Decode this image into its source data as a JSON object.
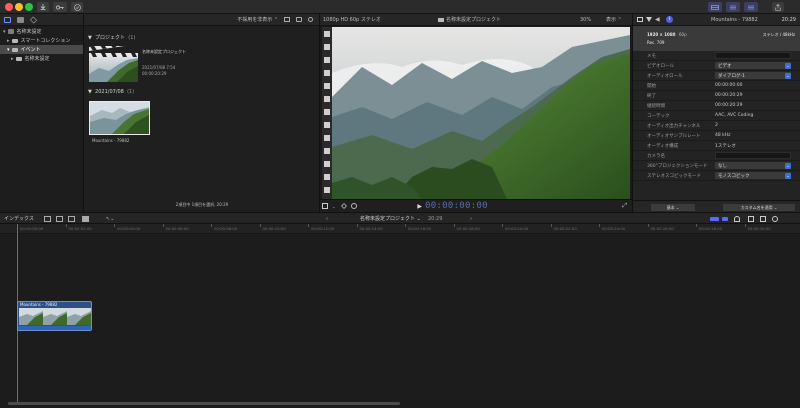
{
  "titlebar": {
    "window_controls": [
      "close",
      "minimize",
      "zoom"
    ],
    "left_buttons": [
      "download-arrow-icon",
      "key-icon",
      "checkmark-icon"
    ],
    "right_buttons": [
      "layout-browser-icon",
      "layout-timeline-icon",
      "layout-inspector-icon"
    ],
    "share_icon": "share-icon"
  },
  "sidebar": {
    "items": [
      {
        "label": "名称未設定",
        "level": 0,
        "expand": "▾"
      },
      {
        "label": "スマートコレクション",
        "level": 1,
        "expand": "▸"
      },
      {
        "label": "イベント",
        "level": 1,
        "expand": "▾",
        "selected": true
      },
      {
        "label": "名称未設定",
        "level": 2,
        "expand": "▸"
      }
    ]
  },
  "browser": {
    "filter_label": "不採用を非表示 ⌃",
    "project_group": {
      "title": "プロジェクト",
      "count": "(1)"
    },
    "project": {
      "name": "名称未設定プロジェクト",
      "date": "2021/07/08 7:54",
      "duration": "00:00:20:29"
    },
    "date_group": {
      "title": "2021/07/08",
      "count": "(1)"
    },
    "clip": {
      "name": "Mountains - 79882"
    },
    "status": "2項目中 1項目を選択, 20:29"
  },
  "viewer": {
    "format": "1080p HD 60p ステレオ",
    "project_name": "名称未設定プロジェクト",
    "zoom": "30%",
    "view_label": "表示 ⌃",
    "timecode": "00:00:00:00"
  },
  "inspector": {
    "clip_name": "Mountains - 79882",
    "duration": "20:29",
    "resolution": "1920 × 1080",
    "framerate": "60p",
    "codec_short": "Rec. 709",
    "audio_info": "ステレオ / 48kHz",
    "rows": [
      {
        "key": "メモ",
        "value": "",
        "type": "field"
      },
      {
        "key": "ビデオロール",
        "value": "ビデオ",
        "type": "pop"
      },
      {
        "key": "オーディオロール",
        "value": "ダイアログ-1",
        "type": "pop"
      },
      {
        "key": "開始",
        "value": "00:00:00:00",
        "type": "text"
      },
      {
        "key": "終了",
        "value": "00:00:20:29",
        "type": "text"
      },
      {
        "key": "継続時間",
        "value": "00:00:20:29",
        "type": "text"
      },
      {
        "key": "コーデック",
        "value": "AAC, AVC Coding",
        "type": "text"
      },
      {
        "key": "オーディオ出力チャンネル",
        "value": "2",
        "type": "text"
      },
      {
        "key": "オーディオサンプルレート",
        "value": "48 kHz",
        "type": "text"
      },
      {
        "key": "オーディオ構成",
        "value": "1ステレオ",
        "type": "text"
      },
      {
        "key": "カメラ名",
        "value": "",
        "type": "field"
      },
      {
        "key": "360°プロジェクションモード",
        "value": "なし",
        "type": "pop"
      },
      {
        "key": "ステレオスコピックモード",
        "value": "モノスコピック",
        "type": "pop"
      }
    ],
    "basic_button": "基本 ⌄",
    "apply_button": "カスタム名を適用 ⌄"
  },
  "timeline": {
    "index_label": "インデックス",
    "project_name": "名称未設定プロジェクト ⌄",
    "duration": "20:29",
    "ruler": [
      "00:00:00:00",
      "00:00:02:00",
      "00:00:04:00",
      "00:00:06:00",
      "00:00:08:00",
      "00:00:10:00",
      "00:00:12:00",
      "00:00:14:00",
      "00:00:16:00",
      "00:00:18:00",
      "00:00:20:00",
      "00:00:22:00",
      "00:00:24:00",
      "00:00:26:00",
      "00:00:28:00",
      "00:00:30:00"
    ],
    "clip_name": "Mountains - 79882"
  },
  "colors": {
    "accent": "#3d6fd8",
    "clip": "#2e4f86",
    "sky": "#cdd6dd",
    "forest": "#2f5a23"
  }
}
